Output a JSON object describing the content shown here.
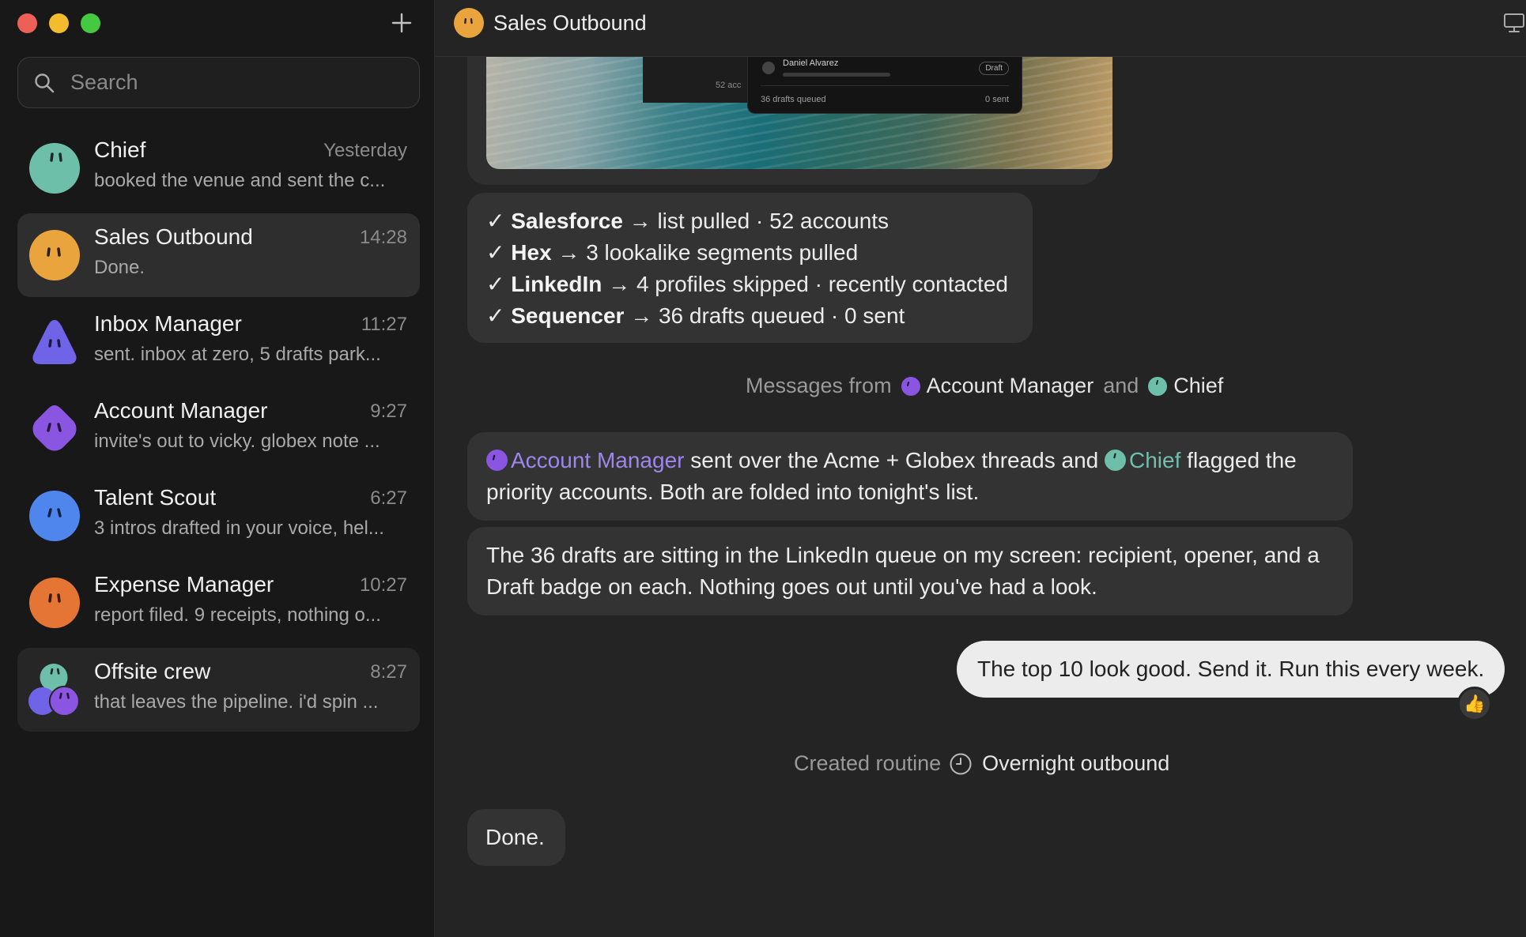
{
  "sidebar": {
    "search_placeholder": "Search",
    "conversations": [
      {
        "name": "Chief",
        "time": "Yesterday",
        "preview": "booked the venue and sent the c...",
        "color": "#6dbfa9"
      },
      {
        "name": "Sales Outbound",
        "time": "14:28",
        "preview": "Done.",
        "color": "#e9a43e"
      },
      {
        "name": "Inbox Manager",
        "time": "11:27",
        "preview": "sent. inbox at zero, 5 drafts park...",
        "color": "#6f63e8"
      },
      {
        "name": "Account Manager",
        "time": "9:27",
        "preview": "invite's out to vicky. globex note ...",
        "color": "#8a55e0"
      },
      {
        "name": "Talent Scout",
        "time": "6:27",
        "preview": "3 intros drafted in your voice, hel...",
        "color": "#4e86ee"
      },
      {
        "name": "Expense Manager",
        "time": "10:27",
        "preview": "report filed. 9 receipts, nothing o...",
        "color": "#e57535"
      },
      {
        "name": "Offsite crew",
        "time": "8:27",
        "preview": "that leaves the pipeline. i'd spin ...",
        "color": "#6dbfa9"
      }
    ]
  },
  "chat": {
    "title": "Sales Outbound",
    "accent": "#e9a43e",
    "preview_card": {
      "name": "Daniel Alvarez",
      "badge": "Draft",
      "accounts": "52 acc",
      "queued": "36 drafts queued",
      "sent": "0 sent"
    },
    "checklist": [
      {
        "check": "✓",
        "tool": "Salesforce",
        "arrow": "→",
        "text": "list pulled · 52 accounts"
      },
      {
        "check": "✓",
        "tool": "Hex",
        "arrow": "→",
        "text": "3 lookalike segments pulled"
      },
      {
        "check": "✓",
        "tool": "LinkedIn",
        "arrow": "→",
        "text": "4 profiles skipped · recently contacted"
      },
      {
        "check": "✓",
        "tool": "Sequencer",
        "arrow": "→",
        "text": "36 drafts queued · 0 sent"
      }
    ],
    "messages_from": {
      "prefix": "Messages from",
      "agent1": "Account Manager",
      "conj": "and",
      "agent2": "Chief"
    },
    "msg1": {
      "agent1": "Account Manager",
      "part1": " sent over the Acme + Globex threads and ",
      "agent2": "Chief",
      "part2": " flagged the priority accounts. Both are folded into tonight's list."
    },
    "msg2": "The 36 drafts are sitting in the LinkedIn queue on my screen: recipient, opener, and a Draft badge on each. Nothing goes out until you've had a look.",
    "user_msg": "The top 10 look good. Send it. Run this every week.",
    "reaction": "👍",
    "routine": {
      "prefix": "Created routine",
      "name": "Overnight outbound"
    },
    "done": "Done."
  }
}
